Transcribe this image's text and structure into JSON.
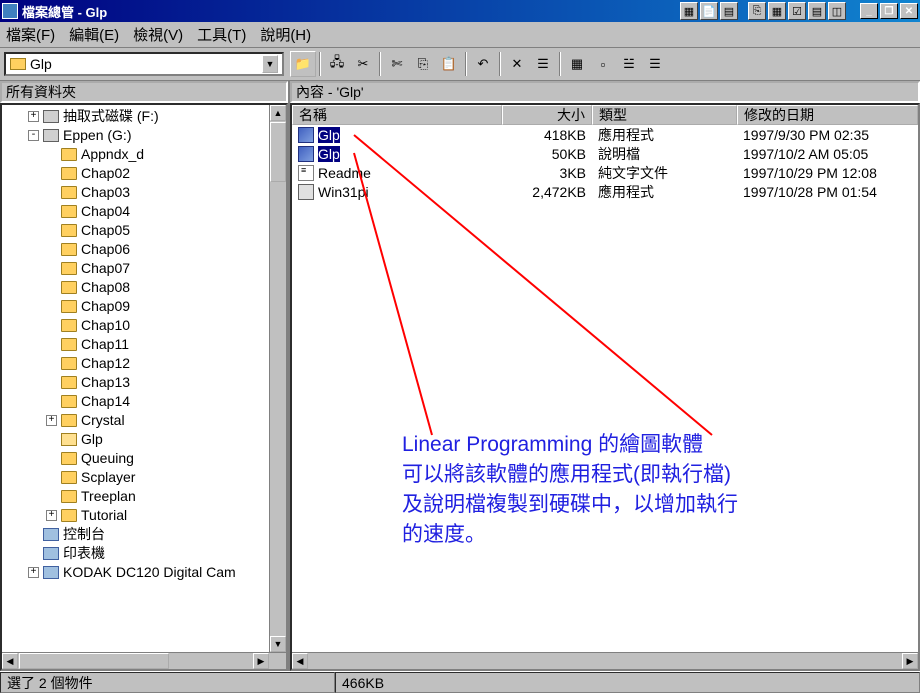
{
  "window": {
    "title": "檔案總管 - Glp"
  },
  "menu": {
    "file": "檔案(F)",
    "edit": "編輯(E)",
    "view": "檢視(V)",
    "tools": "工具(T)",
    "help": "說明(H)"
  },
  "path": {
    "current": "Glp"
  },
  "panes": {
    "left_header": "所有資料夾",
    "right_header": "內容 - 'Glp'"
  },
  "tree": [
    {
      "level": 1,
      "exp": "+",
      "icon": "drive",
      "label": "抽取式磁碟 (F:)"
    },
    {
      "level": 1,
      "exp": "-",
      "icon": "drive",
      "label": "Eppen (G:)"
    },
    {
      "level": 2,
      "exp": "",
      "icon": "folder",
      "label": "Appndx_d"
    },
    {
      "level": 2,
      "exp": "",
      "icon": "folder",
      "label": "Chap02"
    },
    {
      "level": 2,
      "exp": "",
      "icon": "folder",
      "label": "Chap03"
    },
    {
      "level": 2,
      "exp": "",
      "icon": "folder",
      "label": "Chap04"
    },
    {
      "level": 2,
      "exp": "",
      "icon": "folder",
      "label": "Chap05"
    },
    {
      "level": 2,
      "exp": "",
      "icon": "folder",
      "label": "Chap06"
    },
    {
      "level": 2,
      "exp": "",
      "icon": "folder",
      "label": "Chap07"
    },
    {
      "level": 2,
      "exp": "",
      "icon": "folder",
      "label": "Chap08"
    },
    {
      "level": 2,
      "exp": "",
      "icon": "folder",
      "label": "Chap09"
    },
    {
      "level": 2,
      "exp": "",
      "icon": "folder",
      "label": "Chap10"
    },
    {
      "level": 2,
      "exp": "",
      "icon": "folder",
      "label": "Chap11"
    },
    {
      "level": 2,
      "exp": "",
      "icon": "folder",
      "label": "Chap12"
    },
    {
      "level": 2,
      "exp": "",
      "icon": "folder",
      "label": "Chap13"
    },
    {
      "level": 2,
      "exp": "",
      "icon": "folder",
      "label": "Chap14"
    },
    {
      "level": 2,
      "exp": "+",
      "icon": "folder",
      "label": "Crystal"
    },
    {
      "level": 2,
      "exp": "",
      "icon": "folder-open",
      "label": "Glp"
    },
    {
      "level": 2,
      "exp": "",
      "icon": "folder",
      "label": "Queuing"
    },
    {
      "level": 2,
      "exp": "",
      "icon": "folder",
      "label": "Scplayer"
    },
    {
      "level": 2,
      "exp": "",
      "icon": "folder",
      "label": "Treeplan"
    },
    {
      "level": 2,
      "exp": "+",
      "icon": "folder",
      "label": "Tutorial"
    },
    {
      "level": 1,
      "exp": "",
      "icon": "device",
      "label": "控制台"
    },
    {
      "level": 1,
      "exp": "",
      "icon": "device",
      "label": "印表機"
    },
    {
      "level": 1,
      "exp": "+",
      "icon": "device",
      "label": "KODAK DC120 Digital Cam"
    }
  ],
  "columns": {
    "name": "名稱",
    "size": "大小",
    "type": "類型",
    "modified": "修改的日期"
  },
  "files": [
    {
      "icon": "exe",
      "name": "Glp",
      "size": "418KB",
      "type": "應用程式",
      "date": "1997/9/30 PM 02:35",
      "selected": true
    },
    {
      "icon": "exe",
      "name": "Glp",
      "size": "50KB",
      "type": "說明檔",
      "date": "1997/10/2 AM 05:05",
      "selected": true
    },
    {
      "icon": "txt",
      "name": "Readme",
      "size": "3KB",
      "type": "純文字文件",
      "date": "1997/10/29 PM 12:08",
      "selected": false
    },
    {
      "icon": "app",
      "name": "Win31pi",
      "size": "2,472KB",
      "type": "應用程式",
      "date": "1997/10/28 PM 01:54",
      "selected": false
    }
  ],
  "status": {
    "selection": "選了 2 個物件",
    "size": "466KB"
  },
  "annotation": {
    "line1": "Linear Programming 的繪圖軟體",
    "line2": "可以將該軟體的應用程式(即執行檔)",
    "line3": "及說明檔複製到硬碟中，以增加執行",
    "line4": "的速度。"
  }
}
